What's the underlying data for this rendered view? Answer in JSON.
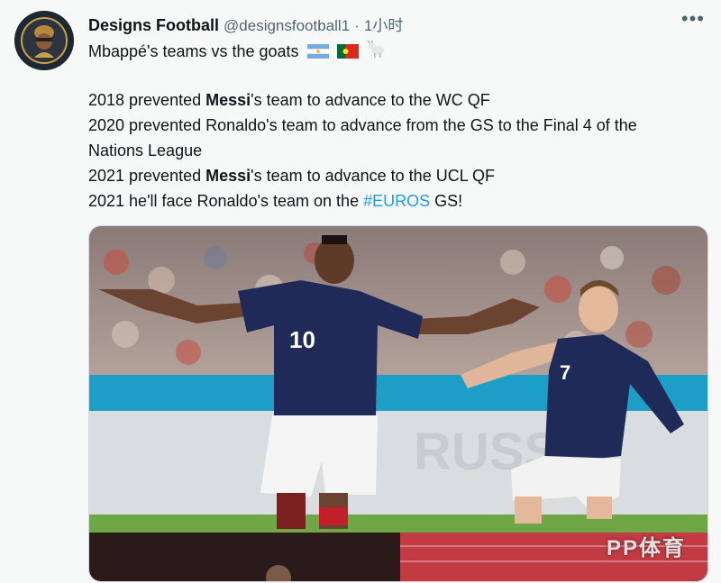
{
  "tweet": {
    "display_name": "Designs Football",
    "handle": "@designsfootball1",
    "separator": "·",
    "time": "1小时",
    "more_icon": "more-horizontal-icon",
    "headline_text": "Mbappé's teams vs the goats",
    "lines": [
      {
        "year": "2018 prevented ",
        "bold": "Messi",
        "rest": "'s team to advance to the WC QF"
      },
      {
        "text": "2020 prevented Ronaldo's team to advance from the GS to the Final 4 of the"
      },
      {
        "text": "Nations League"
      },
      {
        "year": "2021 prevented ",
        "bold": "Messi",
        "rest": "'s team to advance to the UCL QF"
      },
      {
        "prefix": "2021 he'll face Ronaldo's team on the ",
        "hashtag": "#EUROS",
        "suffix": " GS!"
      }
    ],
    "media": {
      "jersey_numbers": [
        "10",
        "7"
      ],
      "watermark": "PP体育"
    }
  }
}
